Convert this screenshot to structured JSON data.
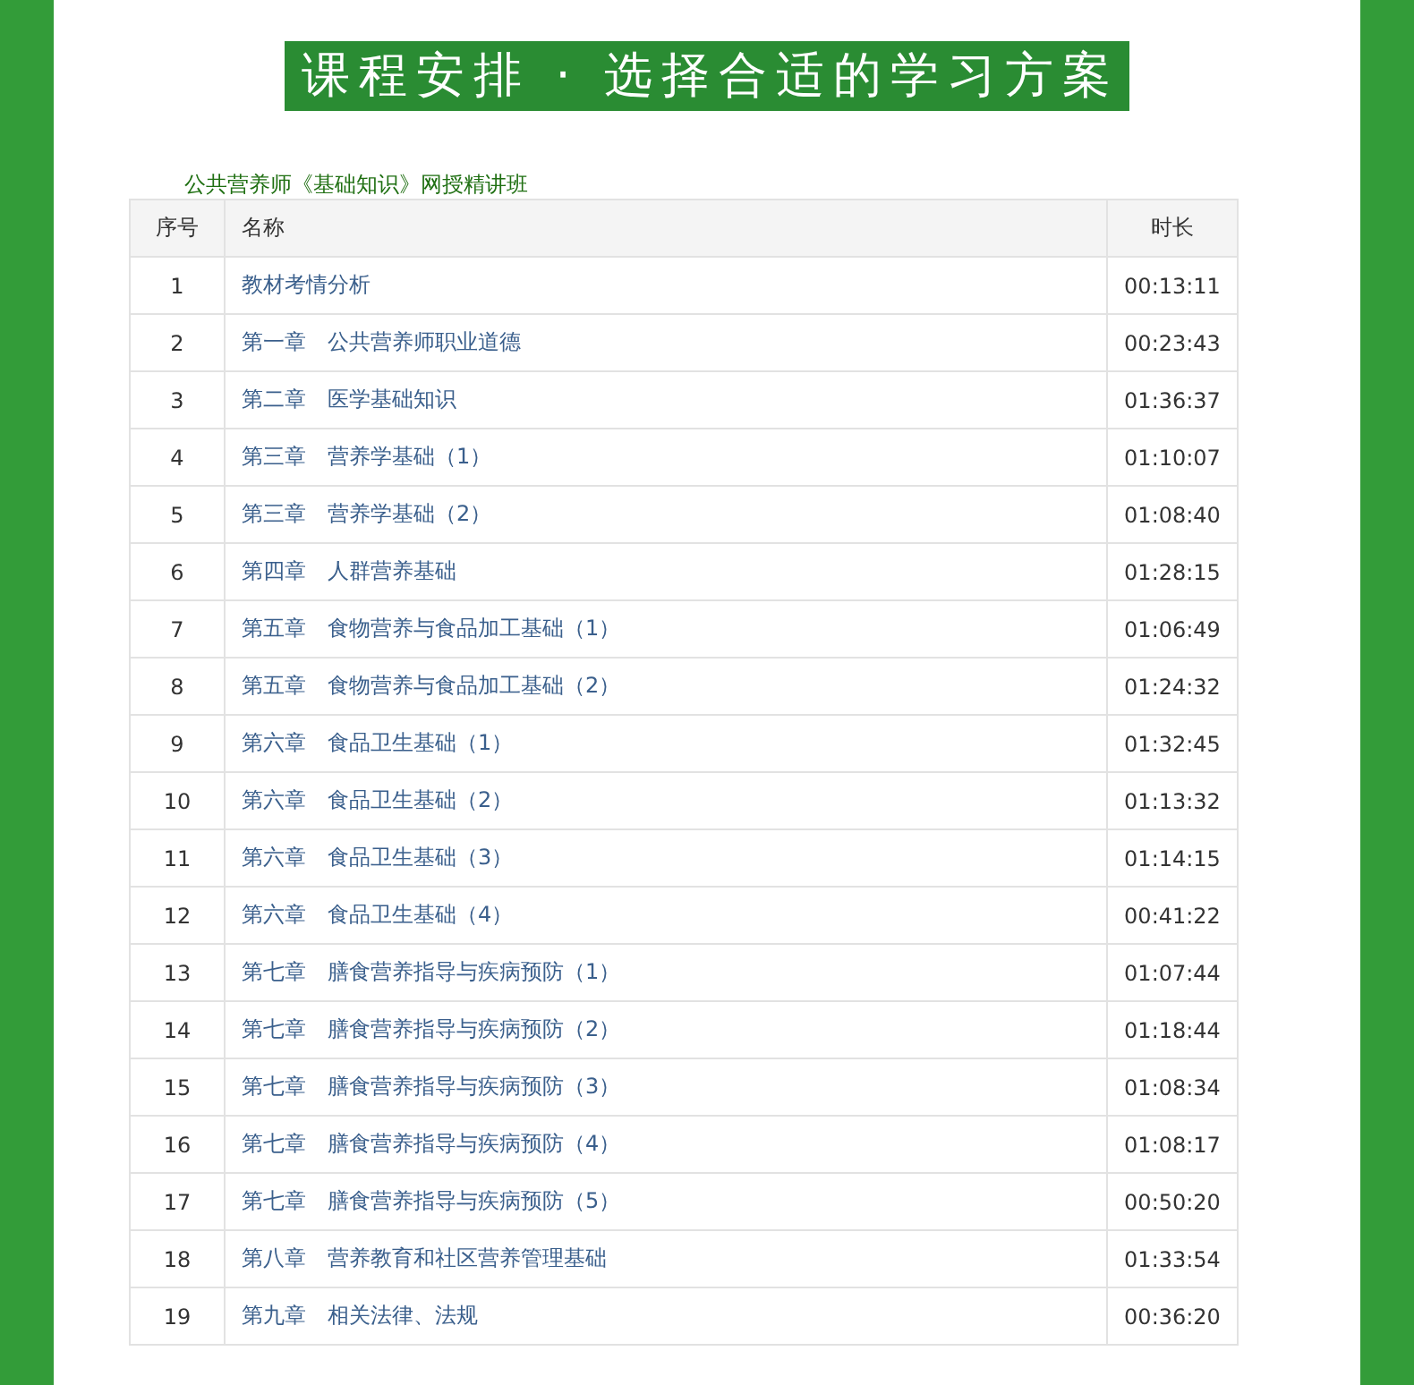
{
  "banner": {
    "title": "课程安排 · 选择合适的学习方案"
  },
  "course": {
    "title": "公共营养师《基础知识》网授精讲班"
  },
  "table": {
    "columns": [
      "序号",
      "名称",
      "时长"
    ],
    "rows": [
      {
        "no": "1",
        "name": "教材考情分析",
        "duration": "00:13:11"
      },
      {
        "no": "2",
        "name": "第一章　公共营养师职业道德",
        "duration": "00:23:43"
      },
      {
        "no": "3",
        "name": "第二章　医学基础知识",
        "duration": "01:36:37"
      },
      {
        "no": "4",
        "name": "第三章　营养学基础（1）",
        "duration": "01:10:07"
      },
      {
        "no": "5",
        "name": "第三章　营养学基础（2）",
        "duration": "01:08:40"
      },
      {
        "no": "6",
        "name": "第四章　人群营养基础",
        "duration": "01:28:15"
      },
      {
        "no": "7",
        "name": "第五章　食物营养与食品加工基础（1）",
        "duration": "01:06:49"
      },
      {
        "no": "8",
        "name": "第五章　食物营养与食品加工基础（2）",
        "duration": "01:24:32"
      },
      {
        "no": "9",
        "name": "第六章　食品卫生基础（1）",
        "duration": "01:32:45"
      },
      {
        "no": "10",
        "name": "第六章　食品卫生基础（2）",
        "duration": "01:13:32"
      },
      {
        "no": "11",
        "name": "第六章　食品卫生基础（3）",
        "duration": "01:14:15"
      },
      {
        "no": "12",
        "name": "第六章　食品卫生基础（4）",
        "duration": "00:41:22"
      },
      {
        "no": "13",
        "name": "第七章　膳食营养指导与疾病预防（1）",
        "duration": "01:07:44"
      },
      {
        "no": "14",
        "name": "第七章　膳食营养指导与疾病预防（2）",
        "duration": "01:18:44"
      },
      {
        "no": "15",
        "name": "第七章　膳食营养指导与疾病预防（3）",
        "duration": "01:08:34"
      },
      {
        "no": "16",
        "name": "第七章　膳食营养指导与疾病预防（4）",
        "duration": "01:08:17"
      },
      {
        "no": "17",
        "name": "第七章　膳食营养指导与疾病预防（5）",
        "duration": "00:50:20"
      },
      {
        "no": "18",
        "name": "第八章　营养教育和社区营养管理基础",
        "duration": "01:33:54"
      },
      {
        "no": "19",
        "name": "第九章　相关法律、法规",
        "duration": "00:36:20"
      }
    ]
  }
}
